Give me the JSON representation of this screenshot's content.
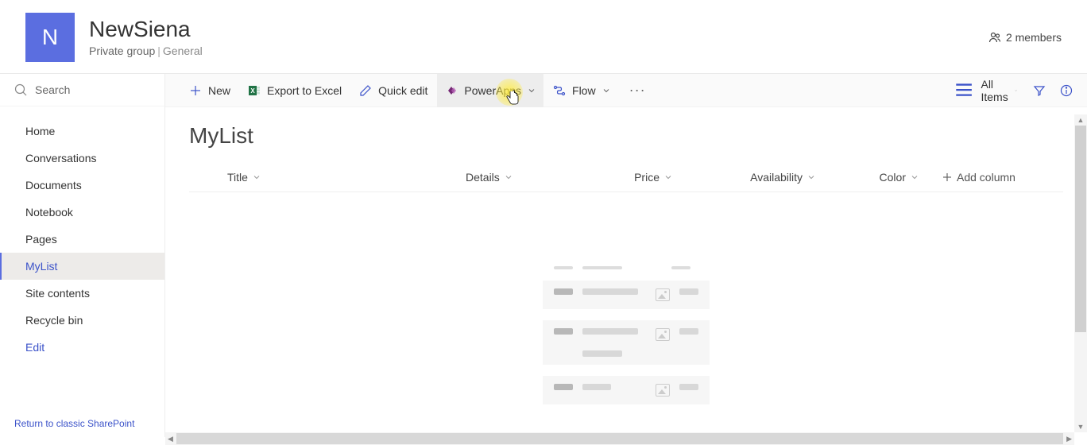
{
  "header": {
    "logo_letter": "N",
    "title": "NewSiena",
    "group_type": "Private group",
    "classification": "General",
    "members_label": "2 members"
  },
  "search": {
    "placeholder": "Search"
  },
  "nav": {
    "items": [
      {
        "label": "Home"
      },
      {
        "label": "Conversations"
      },
      {
        "label": "Documents"
      },
      {
        "label": "Notebook"
      },
      {
        "label": "Pages"
      },
      {
        "label": "MyList",
        "selected": true
      },
      {
        "label": "Site contents"
      },
      {
        "label": "Recycle bin"
      },
      {
        "label": "Edit",
        "link": true
      }
    ],
    "return_link": "Return to classic SharePoint"
  },
  "commands": {
    "new": "New",
    "export": "Export to Excel",
    "quick_edit": "Quick edit",
    "powerapps": "PowerApps",
    "flow": "Flow",
    "view": "All Items"
  },
  "list": {
    "title": "MyList",
    "columns": {
      "title": "Title",
      "details": "Details",
      "price": "Price",
      "availability": "Availability",
      "color": "Color",
      "add": "Add column"
    }
  }
}
